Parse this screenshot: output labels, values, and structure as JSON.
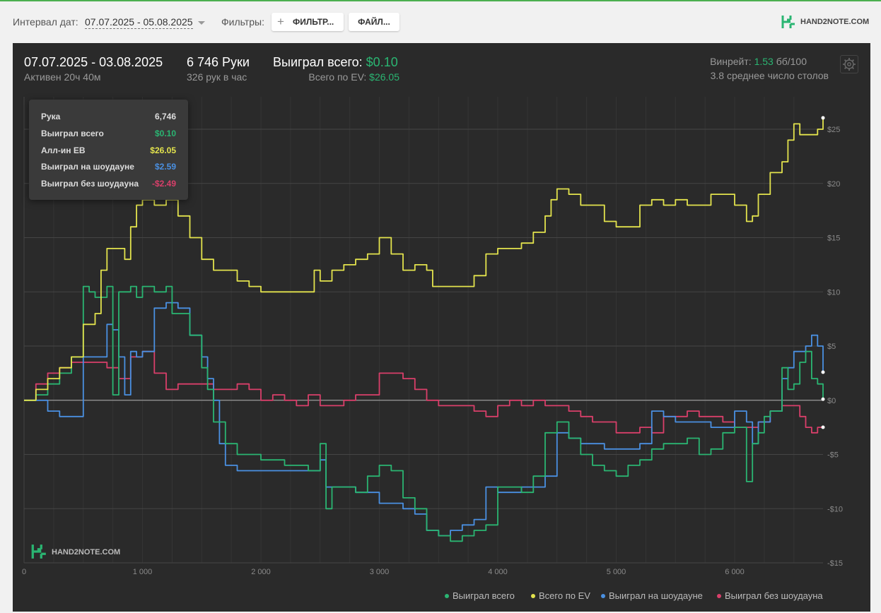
{
  "toolbar": {
    "interval_label": "Интервал дат:",
    "interval_value": "07.07.2025 - 05.08.2025",
    "filters_label": "Фильтры:",
    "filter_button": "ФИЛЬТР...",
    "file_button": "ФАЙЛ...",
    "logo": "HAND2NOTE.COM"
  },
  "header": {
    "date_range": "07.07.2025 - 03.08.2025",
    "active": "Активен 20ч 40м",
    "hands": "6 746 Руки",
    "hands_per_hour": "326 рук в час",
    "won_label": "Выиграл всего:",
    "won_value": "$0.10",
    "ev_label": "Всего по EV:",
    "ev_value": "$26.05",
    "winrate_label": "Винрейт:",
    "winrate_value": "1.53",
    "winrate_unit": "бб/100",
    "tables": "3.8 среднее число столов"
  },
  "tooltip": {
    "rows": [
      {
        "label": "Рука",
        "value": "6,746",
        "color": "#dddddd"
      },
      {
        "label": "Выиграл всего",
        "value": "$0.10",
        "color": "#2ab572"
      },
      {
        "label": "Алл-ин EВ",
        "value": "$26.05",
        "color": "#e3e34d"
      },
      {
        "label": "Выиграл на шоудауне",
        "value": "$2.59",
        "color": "#4a90e2"
      },
      {
        "label": "Выиграл без шоудауна",
        "value": "-$2.49",
        "color": "#d93f6a"
      }
    ]
  },
  "watermark": "HAND2NOTE.COM",
  "chart_data": {
    "type": "line",
    "xlim": [
      0,
      6746
    ],
    "ylim": [
      -15,
      28
    ],
    "x_ticks": [
      0,
      1000,
      2000,
      3000,
      4000,
      5000,
      6000
    ],
    "x_tick_labels": [
      "0",
      "1 000",
      "2 000",
      "3 000",
      "4 000",
      "5 000",
      "6 000"
    ],
    "y_ticks": [
      25,
      20,
      15,
      10,
      5,
      0,
      -5,
      -10,
      -15
    ],
    "y_tick_labels": [
      "$25",
      "$20",
      "$15",
      "$10",
      "$5",
      "$0",
      "-$5",
      "-$10",
      "-$15"
    ],
    "grid": true,
    "legend_position": "bottom-right",
    "series": [
      {
        "name": "Выиграл всего",
        "color": "#2ab572",
        "x": [
          0,
          100,
          200,
          300,
          400,
          500,
          550,
          600,
          700,
          750,
          800,
          850,
          900,
          950,
          1000,
          1100,
          1200,
          1250,
          1300,
          1400,
          1500,
          1550,
          1600,
          1700,
          1800,
          2000,
          2200,
          2400,
          2500,
          2550,
          2600,
          2700,
          2800,
          2900,
          3000,
          3100,
          3200,
          3300,
          3400,
          3500,
          3600,
          3700,
          3800,
          3900,
          4000,
          4100,
          4200,
          4300,
          4400,
          4500,
          4600,
          4700,
          4800,
          4900,
          5000,
          5100,
          5200,
          5300,
          5400,
          5500,
          5600,
          5700,
          5800,
          5900,
          6000,
          6100,
          6150,
          6200,
          6250,
          6300,
          6400,
          6450,
          6500,
          6550,
          6600,
          6650,
          6700,
          6746
        ],
        "y": [
          0,
          0.5,
          1.5,
          2.5,
          4,
          10.5,
          10,
          9.5,
          10.5,
          0.5,
          10,
          10,
          10.5,
          9.5,
          10.5,
          10,
          10.5,
          8,
          8,
          6,
          3,
          1,
          -2,
          -4,
          -5,
          -5.5,
          -6,
          -6.5,
          -4,
          -10,
          -8,
          -8,
          -8.5,
          -7,
          -6,
          -6.5,
          -9,
          -10,
          -12,
          -12.5,
          -13,
          -12.5,
          -12,
          -11.5,
          -8,
          -8,
          -8.5,
          -7,
          -3,
          -2,
          -3.5,
          -5,
          -6,
          -6.5,
          -7,
          -6,
          -5.5,
          -4.5,
          -4,
          -4,
          -3.5,
          -5,
          -4.5,
          -3,
          -2.5,
          -7.5,
          -4,
          -3,
          -1.5,
          -1,
          3,
          1,
          1.5,
          3.5,
          4.5,
          2,
          1.5,
          0.1
        ]
      },
      {
        "name": "Всего по EV",
        "color": "#e3e34d",
        "x": [
          0,
          100,
          200,
          300,
          400,
          500,
          600,
          650,
          700,
          800,
          850,
          900,
          950,
          1000,
          1100,
          1200,
          1300,
          1400,
          1500,
          1600,
          1700,
          1800,
          1900,
          2000,
          2200,
          2400,
          2450,
          2500,
          2600,
          2700,
          2800,
          2900,
          3000,
          3100,
          3200,
          3300,
          3400,
          3450,
          3500,
          3600,
          3700,
          3800,
          3900,
          4000,
          4100,
          4200,
          4300,
          4400,
          4450,
          4500,
          4600,
          4700,
          4800,
          4900,
          5000,
          5100,
          5200,
          5300,
          5400,
          5500,
          5600,
          5700,
          5800,
          5900,
          6000,
          6100,
          6150,
          6200,
          6300,
          6400,
          6450,
          6500,
          6550,
          6600,
          6650,
          6700,
          6746
        ],
        "y": [
          0,
          1,
          2,
          3,
          4,
          7,
          8,
          12,
          14,
          14,
          13,
          16,
          18,
          18.5,
          18,
          18.5,
          17,
          15,
          13,
          12,
          12,
          11,
          10.5,
          10,
          10,
          10,
          12,
          11,
          12,
          12.5,
          13,
          13.5,
          15,
          13.5,
          12,
          12.5,
          12,
          10.5,
          10.5,
          10.5,
          10.5,
          11.5,
          13.5,
          14,
          14,
          14.5,
          15.5,
          17,
          18.5,
          19.5,
          19,
          18,
          18,
          16.5,
          16,
          16,
          18,
          18.5,
          18,
          18.5,
          18,
          18,
          19,
          19,
          18,
          16.5,
          17,
          19,
          21,
          22,
          24,
          25.5,
          24.5,
          24.5,
          24.5,
          25,
          26.05
        ]
      },
      {
        "name": "Выиграл на шоудауне",
        "color": "#4a90e2",
        "x": [
          0,
          200,
          300,
          400,
          500,
          700,
          750,
          800,
          850,
          900,
          950,
          1000,
          1100,
          1200,
          1300,
          1400,
          1500,
          1550,
          1600,
          1650,
          1700,
          1800,
          2000,
          2300,
          2400,
          2500,
          2550,
          2600,
          2800,
          3000,
          3100,
          3200,
          3300,
          3400,
          3500,
          3600,
          3700,
          3800,
          3900,
          4000,
          4100,
          4200,
          4300,
          4400,
          4500,
          4600,
          4700,
          4800,
          4900,
          5000,
          5100,
          5200,
          5300,
          5400,
          5500,
          5600,
          5700,
          5800,
          5900,
          6000,
          6100,
          6150,
          6200,
          6300,
          6400,
          6450,
          6500,
          6550,
          6600,
          6650,
          6700,
          6746
        ],
        "y": [
          0,
          -1,
          -1.5,
          -1.5,
          4,
          7,
          6.5,
          4,
          0.5,
          4.5,
          4,
          4.5,
          8.5,
          9,
          8.5,
          6,
          4,
          2,
          0,
          -4,
          -6,
          -6.5,
          -6.5,
          -6.5,
          -6.5,
          -5.5,
          -8,
          -8,
          -8.5,
          -9.5,
          -9.5,
          -10,
          -10.5,
          -12,
          -12.5,
          -12,
          -11.5,
          -11,
          -8,
          -8.5,
          -8.5,
          -8,
          -8,
          -7,
          -3,
          -3.5,
          -4,
          -4,
          -4.5,
          -4.5,
          -4.5,
          -4,
          -1,
          -1.5,
          -2,
          -2,
          -2,
          -2.5,
          -2.5,
          -1,
          -2,
          -4,
          -2,
          -1,
          2,
          3,
          4.5,
          4.5,
          5,
          6,
          5,
          2.59
        ]
      },
      {
        "name": "Выиграл без шоудауна",
        "color": "#d93f6a",
        "x": [
          0,
          100,
          200,
          300,
          400,
          500,
          600,
          700,
          800,
          900,
          1000,
          1100,
          1200,
          1300,
          1400,
          1500,
          1600,
          1700,
          1800,
          1900,
          2000,
          2100,
          2200,
          2300,
          2400,
          2500,
          2600,
          2700,
          2800,
          2900,
          3000,
          3100,
          3200,
          3300,
          3400,
          3500,
          3600,
          3700,
          3800,
          3900,
          4000,
          4100,
          4200,
          4300,
          4400,
          4500,
          4600,
          4700,
          4800,
          4900,
          5000,
          5100,
          5200,
          5300,
          5400,
          5500,
          5600,
          5700,
          5800,
          5900,
          6000,
          6100,
          6200,
          6300,
          6400,
          6500,
          6550,
          6600,
          6650,
          6700,
          6746
        ],
        "y": [
          0,
          1.5,
          2.5,
          3,
          3.5,
          3.5,
          3.5,
          3,
          2,
          4,
          4.5,
          2.5,
          1,
          1.5,
          1.5,
          1.5,
          1,
          1,
          1.5,
          1,
          0,
          0.5,
          0,
          -0.5,
          0.5,
          -0.5,
          -0.5,
          0,
          0.5,
          0.5,
          2.5,
          2.5,
          2,
          1,
          0,
          -0.5,
          -0.5,
          -0.5,
          -1,
          -1.5,
          -0.5,
          0,
          -0.5,
          0,
          -0.5,
          -0.5,
          -1,
          -1.5,
          -2,
          -2,
          -3,
          -3,
          -2.5,
          -3,
          -1.5,
          -1.5,
          -1,
          -1.5,
          -1.5,
          -2,
          -2.5,
          -2.5,
          -2,
          -1,
          -0.5,
          -0.5,
          -1.5,
          -2.5,
          -3,
          -2.5,
          -2.49
        ]
      }
    ]
  }
}
